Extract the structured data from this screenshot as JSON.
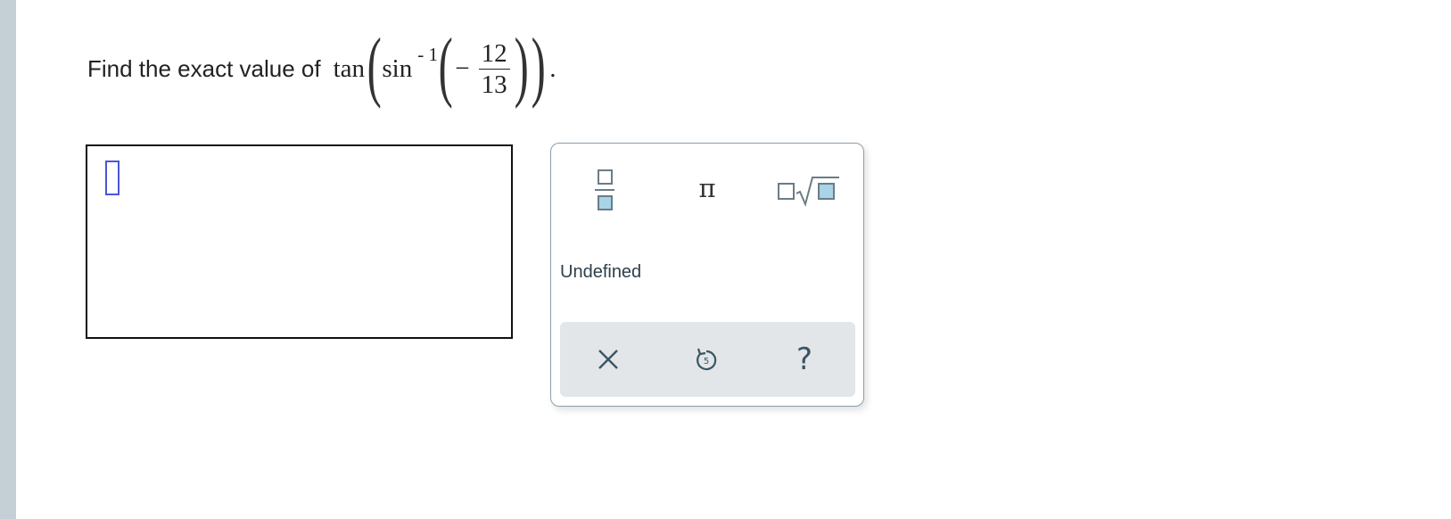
{
  "question": {
    "prompt": "Find the exact value of",
    "func_outer": "tan",
    "func_inner": "sin",
    "inverse_exponent": "- 1",
    "sign": "−",
    "numerator": "12",
    "denominator": "13",
    "period": "."
  },
  "answer": {
    "value": ""
  },
  "keypad": {
    "pi_label": "π",
    "undefined_label": "Undefined",
    "help_label": "?",
    "icons": {
      "fraction": "fraction-icon",
      "pi": "pi-icon",
      "nth_root": "nth-root-icon",
      "clear": "clear-icon",
      "undo": "undo-icon",
      "help": "help-icon"
    },
    "accent_color": "#a7d4e6",
    "icon_color": "#6b7c86"
  },
  "colors": {
    "left_rail": "#c5d0d6",
    "cursor": "#4a56d6",
    "toolbar_bg": "#e2e6e9"
  }
}
